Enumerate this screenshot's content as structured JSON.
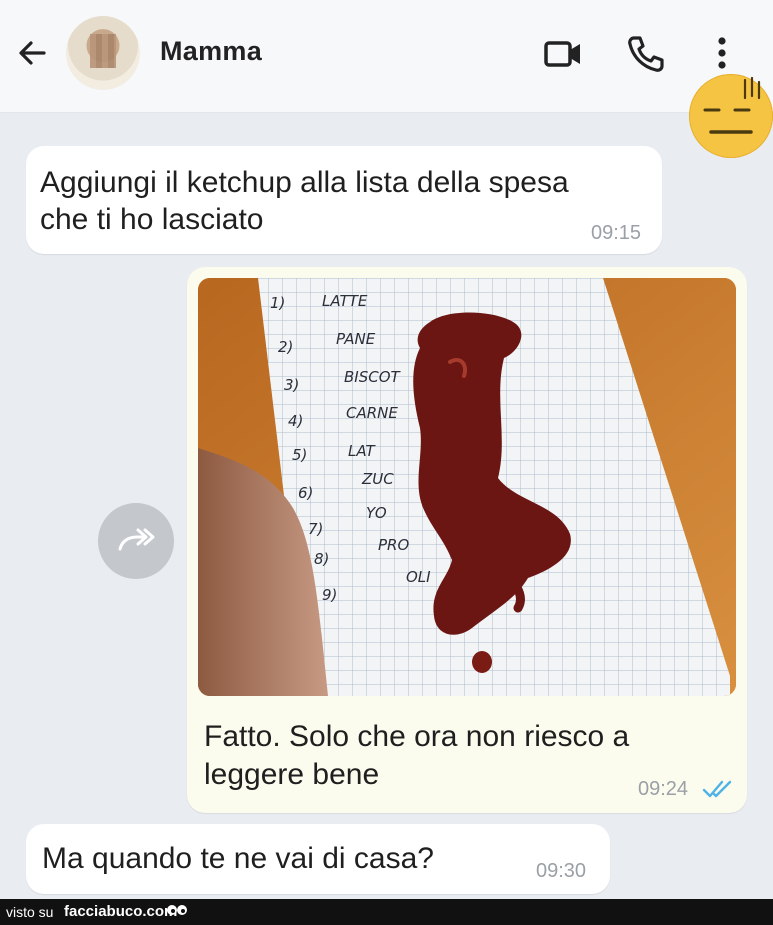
{
  "header": {
    "contact_name": "Mamma",
    "icons": [
      "back-arrow-icon",
      "avatar",
      "video-call-icon",
      "voice-call-icon",
      "more-options-icon"
    ],
    "emoji": "neutral-face-emoji"
  },
  "messages": [
    {
      "direction": "incoming",
      "text_line1": "Aggiungi il ketchup alla lista della spesa",
      "text_line2": "che ti ho lasciato",
      "time": "09:15"
    },
    {
      "direction": "outgoing",
      "has_image": true,
      "text_line1": "Fatto. Solo che ora non riesco a",
      "text_line2": "leggere bene",
      "time": "09:24",
      "status": "read-double-check-icon"
    },
    {
      "direction": "incoming",
      "text_line1": "Ma quando te ne vai di casa?",
      "time": "09:30"
    }
  ],
  "photo": {
    "list_items": [
      "LATTE",
      "PANE",
      "BISCOT",
      "CARNE",
      "LAT",
      "ZUC",
      "YO",
      "PRO",
      "OLI"
    ],
    "list_numbers": [
      "1)",
      "2)",
      "3)",
      "4)",
      "5)",
      "6)",
      "7)",
      "8)",
      "9)"
    ]
  },
  "footer": {
    "prefix": "visto su",
    "site": "facciabuco.com"
  },
  "colors": {
    "incoming_bubble": "#ffffff",
    "outgoing_bubble": "#fbfbee",
    "background": "#e9ecf1",
    "read_ticks": "#4fb3e6",
    "ketchup": "#6b1612"
  }
}
